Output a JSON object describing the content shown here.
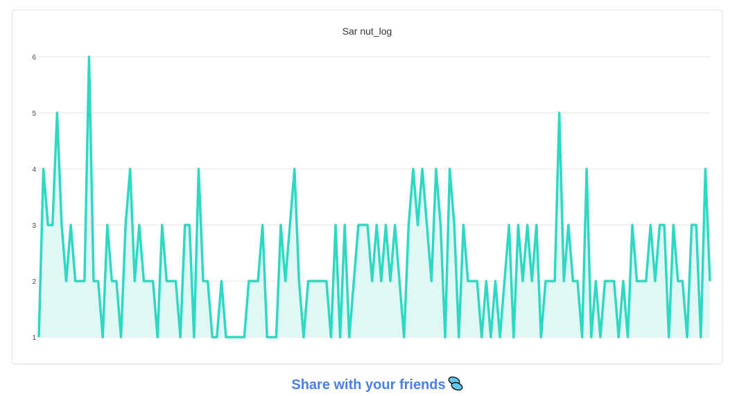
{
  "chart_data": {
    "type": "area",
    "title": "Sar nut_log",
    "xlabel": "",
    "ylabel": "",
    "ylim": [
      1,
      6
    ],
    "yticks": [
      "1",
      "2",
      "3",
      "4",
      "5",
      "6"
    ],
    "grid": true,
    "legend": "none",
    "line_color": "#2ed8c3",
    "fill_color": "#e0f7f4",
    "series": [
      {
        "values": [
          1,
          4,
          3,
          3,
          5,
          3,
          2,
          3,
          2,
          2,
          2,
          6,
          2,
          2,
          1,
          3,
          2,
          2,
          1,
          3,
          4,
          2,
          3,
          2,
          2,
          2,
          1,
          3,
          2,
          2,
          2,
          1,
          3,
          3,
          1,
          4,
          2,
          2,
          1,
          1,
          2,
          1,
          1,
          1,
          1,
          1,
          2,
          2,
          2,
          3,
          1,
          1,
          1,
          3,
          2,
          3,
          4,
          2,
          1,
          2,
          2,
          2,
          2,
          2,
          1,
          3,
          1,
          3,
          1,
          2,
          3,
          3,
          3,
          2,
          3,
          2,
          3,
          2,
          3,
          2,
          1,
          3,
          4,
          3,
          4,
          3,
          2,
          4,
          3,
          1,
          4,
          3,
          1,
          3,
          2,
          2,
          2,
          1,
          2,
          1,
          2,
          1,
          2,
          3,
          1,
          3,
          2,
          3,
          2,
          3,
          1,
          2,
          2,
          2,
          5,
          2,
          3,
          2,
          2,
          1,
          4,
          1,
          2,
          1,
          2,
          2,
          2,
          1,
          2,
          1,
          3,
          2,
          2,
          2,
          3,
          2,
          3,
          3,
          1,
          3,
          2,
          2,
          1,
          3,
          3,
          1,
          4,
          2
        ]
      }
    ]
  },
  "footer": {
    "share_label": "Share with your friends"
  }
}
